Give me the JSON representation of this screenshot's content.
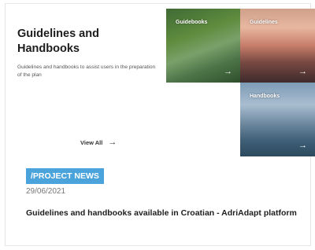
{
  "intro": {
    "title": "Guidelines and Handbooks",
    "description": "Guidelines and handbooks to assist users in the preparation of the plan",
    "view_all_label": "View All",
    "view_all_icon": "arrow-right-icon"
  },
  "tiles": [
    {
      "label": "Guidebooks",
      "icon": "arrow-right-icon"
    },
    {
      "label": "Guidelines",
      "icon": "arrow-right-icon"
    },
    {
      "label": "Handbooks",
      "icon": "arrow-right-icon"
    }
  ],
  "news": {
    "badge": "/PROJECT NEWS",
    "date": "29/06/2021",
    "title": "Guidelines and handbooks available in Croatian - AdriAdapt platform"
  },
  "colors": {
    "badge_background": "#4ba3db",
    "title_text": "#1d1d1d"
  }
}
